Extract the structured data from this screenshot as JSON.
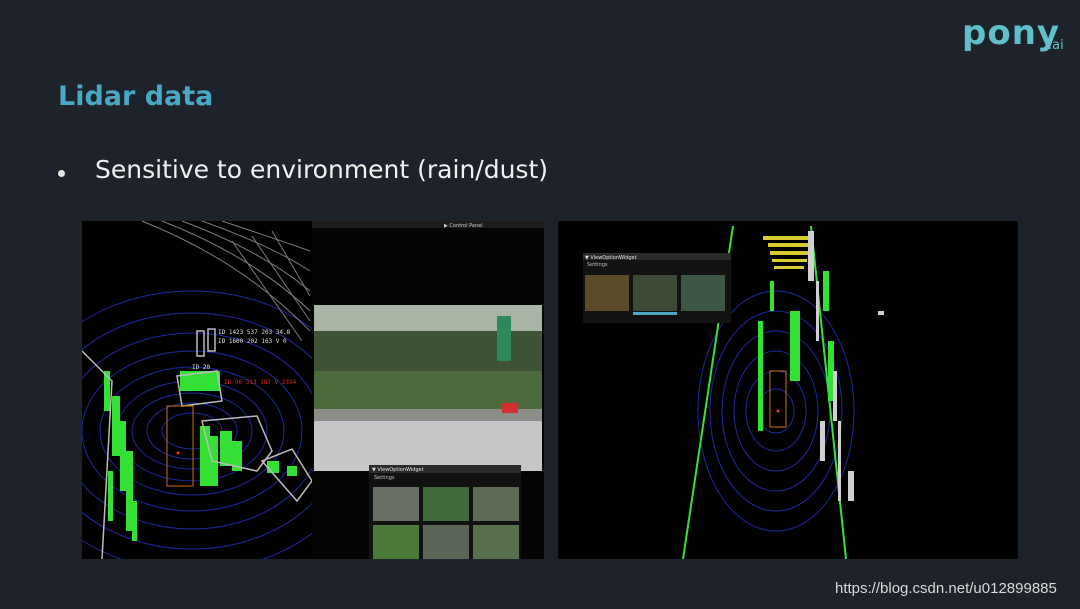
{
  "logo": {
    "word": "pony",
    "suffix": ".ai"
  },
  "slide": {
    "title": "Lidar data",
    "bullets": [
      "Sensitive to environment (rain/dust)"
    ]
  },
  "left_panel": {
    "control_panel_label": "▶ Control Panel",
    "view_widget_title": "▼ ViewOptionWidget",
    "view_widget_settings": "Settings",
    "annotations": [
      "ID 1423 537 203 34.8",
      "ID 1600 202 163 V 0",
      "ID 20",
      "ID 96 313 187 V 2394"
    ]
  },
  "right_panel": {
    "view_widget_title": "▼ ViewOptionWidget",
    "view_widget_settings": "Settings"
  },
  "watermark": "https://blog.csdn.net/u012899885",
  "colors": {
    "background": "#1e222a",
    "accent": "#49a8c4",
    "logo": "#5fbfca",
    "point_cloud": "#39e639",
    "lidar_rings": "#1f2a8f"
  }
}
